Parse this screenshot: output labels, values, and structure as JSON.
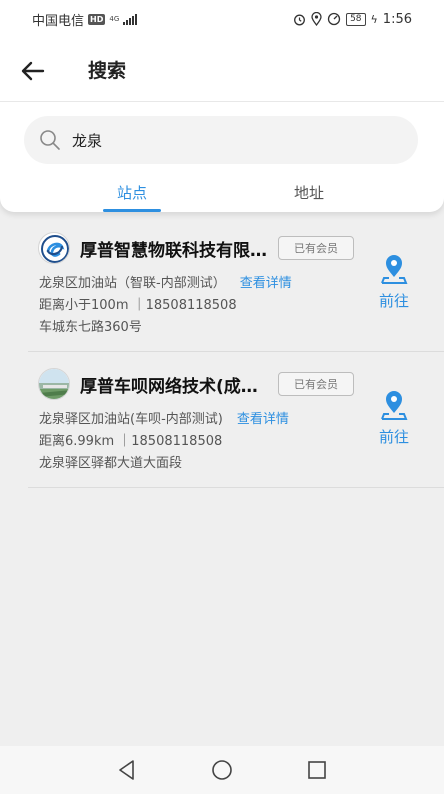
{
  "status_bar": {
    "carrier": "中国电信",
    "hd": "HD",
    "network": "4G",
    "battery": "58",
    "time": "1:56"
  },
  "header": {
    "title": "搜索"
  },
  "search": {
    "value": "龙泉"
  },
  "tabs": [
    {
      "label": "站点",
      "active": true
    },
    {
      "label": "地址",
      "active": false
    }
  ],
  "stations": [
    {
      "name": "厚普智慧物联科技有限公司",
      "badge": "已有会员",
      "station_label": "龙泉区加油站（智联-内部测试）",
      "details": "查看详情",
      "distance_phone": "距离小于100m ｜18508118508",
      "address": "车城东七路360号",
      "go": "前往",
      "logo": "swirl-logo"
    },
    {
      "name": "厚普车呗网络技术(成都)有限公司",
      "badge": "已有会员",
      "station_label": "龙泉驿区加油站(车呗-内部测试)",
      "details": "查看详情",
      "distance_phone": "距离6.99km ｜18508118508",
      "address": "龙泉驿区驿都大道大面段",
      "go": "前往",
      "logo": "landscape-logo"
    }
  ],
  "colors": {
    "accent": "#2d8fe0",
    "background": "#efefef"
  }
}
